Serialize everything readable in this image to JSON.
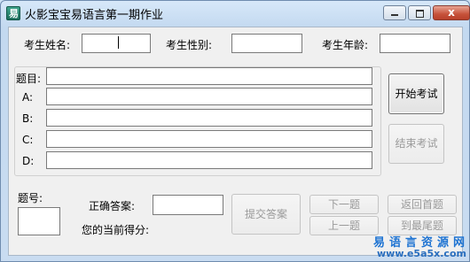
{
  "window": {
    "title": "火影宝宝易语言第一期作业",
    "close_glyph": "x"
  },
  "header": {
    "name_label": "考生姓名:",
    "name_value": "",
    "gender_label": "考生性别:",
    "gender_value": "",
    "age_label": "考生年龄:",
    "age_value": ""
  },
  "question": {
    "title_label": "题目:",
    "options": [
      {
        "label": "A:",
        "value": ""
      },
      {
        "label": "B:",
        "value": ""
      },
      {
        "label": "C:",
        "value": ""
      },
      {
        "label": "D:",
        "value": ""
      }
    ]
  },
  "buttons": {
    "start": "开始考试",
    "end": "结束考试",
    "submit": "提交答案",
    "next": "下一题",
    "prev": "上一题",
    "first": "返回首题",
    "last": "到最尾题"
  },
  "footer": {
    "number_label": "题号:",
    "number_value": "",
    "correct_label": "正确答案:",
    "correct_value": "",
    "score_label": "您的当前得分:"
  },
  "watermark": {
    "line1": "易语言资源网",
    "line2": "www.e5a5x.com"
  },
  "icons": [
    "app-icon",
    "minimize-icon",
    "maximize-icon",
    "close-icon"
  ]
}
